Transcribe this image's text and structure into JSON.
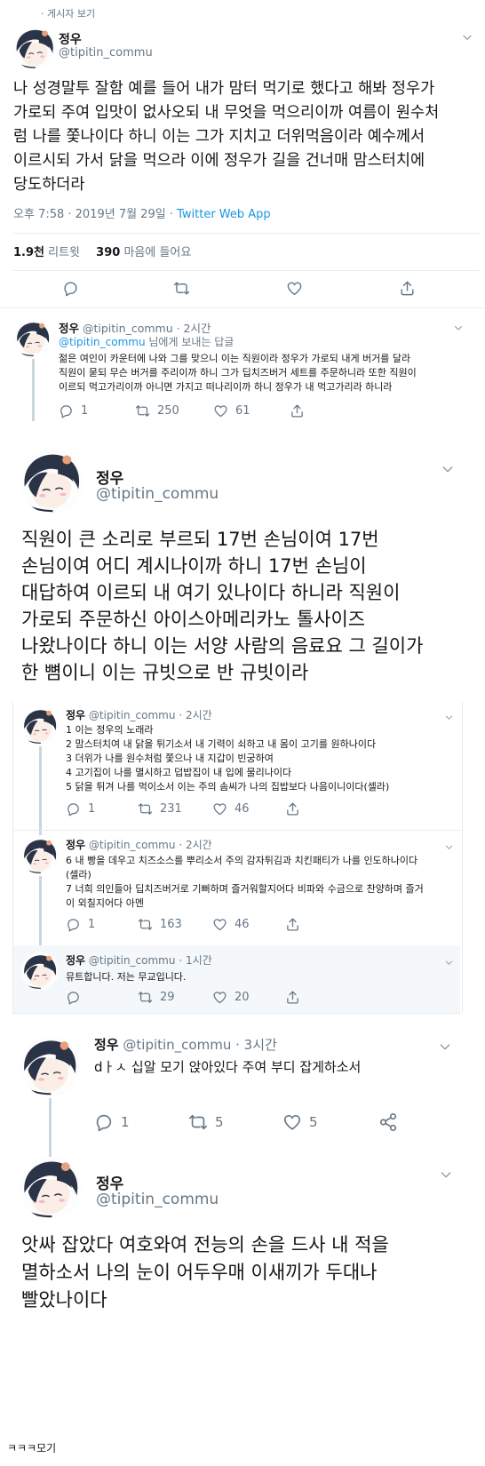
{
  "top_fragment": "· 게시자 보기",
  "main": {
    "name": "정우",
    "handle": "@tipitin_commu",
    "lines": [
      "나 성경말투 잘함 예를 들어 내가 맘터 먹기로 했다고 해봐 정우가",
      "가로되 주여 입맛이 없사오되 내 무엇을 먹으리이까 여름이 원수처",
      "럼 나를 쫓나이다 하니 이는 그가 지치고 더위먹음이라 예수께서",
      "이르시되 가서 닭을 먹으라 이에 정우가 길을 건너매 맘스터치에",
      "당도하더라"
    ],
    "timestamp": "오후 7:58 · 2019년 7월 29일 · ",
    "source": "Twitter Web App",
    "retweets_count": "1.9천",
    "retweets_label": "리트윗",
    "likes_count": "390",
    "likes_label": "마음에 들어요"
  },
  "reply1": {
    "name": "정우",
    "handle": "@tipitin_commu",
    "time": "· 2시간",
    "replying_handle": "@tipitin_commu",
    "replying_suffix": "님에게 보내는 답글",
    "lines": [
      "젊은 여인이 카운터에 나와 그를 맞으니 이는 직원이라 정우가 가로되 내게 버거를 달라",
      "직원이 묻되 무슨 버거를 주리이까 하니 그가 딥치즈버거 세트를 주문하니라 또한 직원이",
      "이르되 먹고가리이까 아니면 가지고 떠나리이까 하니 정우가 내 먹고가리라 하니라"
    ],
    "replies": "1",
    "retweets": "250",
    "likes": "61"
  },
  "big1": {
    "name": "정우",
    "handle": "@tipitin_commu",
    "lines": [
      "직원이 큰 소리로 부르되 17번 손님이여 17번",
      "손님이여 어디 계시나이까 하니 17번 손님이",
      "대답하여 이르되 내 여기 있나이다 하니라 직원이",
      "가로되 주문하신 아이스아메리카노 톨사이즈",
      "나왔나이다 하니 이는 서양 사람의 음료요 그 길이가",
      "한 뼘이니 이는 규빗으로 반 규빗이라"
    ]
  },
  "inner1": {
    "name": "정우",
    "handle": "@tipitin_commu",
    "time": "· 2시간",
    "lines": [
      "1 이는 정우의 노래라",
      "2 맘스터치여 내 닭을 튀기소서 내 기력이 쇠하고 내 몸이 고기를 원하나이다",
      "3 더위가 나를 원수처럼 쫓으나 내 지갑이 빈궁하여",
      "4 고기집이 나를 멸시하고 덥밥집이 내 입에 물리나이다",
      "5 닭을 튀겨 나를 먹이소서 이는 주의 솜씨가 나의 집밥보다 나음이니이다(셀라)"
    ],
    "replies": "1",
    "retweets": "231",
    "likes": "46"
  },
  "inner2": {
    "name": "정우",
    "handle": "@tipitin_commu",
    "time": "· 2시간",
    "lines": [
      "6 내 빵을 데우고 치즈소스를 뿌리소서 주의 감자튀김과 치킨패티가 나를 인도하나이다",
      "(셀라)",
      "7 너희 의인들아 딥치즈버거로 기뻐하며 즐거워할지어다 비파와 수금으로 찬양하며 즐거",
      "이 외칠지어다 아멘"
    ],
    "replies": "1",
    "retweets": "163",
    "likes": "46"
  },
  "inner3": {
    "name": "정우",
    "handle": "@tipitin_commu",
    "time": "· 1시간",
    "text": "뮤트합니다. 저는 무교입니다.",
    "retweets": "29",
    "likes": "20"
  },
  "reply2": {
    "name": "정우",
    "handle": "@tipitin_commu",
    "time": "· 3시간",
    "text": "dㅏㅅ 십알 모기 앉아있다 주여 부디 잡게하소서",
    "replies": "1",
    "retweets": "5",
    "likes": "5"
  },
  "big2": {
    "name": "정우",
    "handle": "@tipitin_commu",
    "lines": [
      "앗싸 잡았다 여호와여 전능의 손을 드사 내 적을",
      "멸하소서 나의 눈이 어두우매 이새끼가 두대나",
      "빨았나이다"
    ]
  },
  "footer_caption": "ㅋㅋㅋ모기",
  "icons": {
    "reply": "reply-icon",
    "retweet": "retweet-icon",
    "like": "heart-icon",
    "share": "share-icon",
    "more": "chevron-down-icon"
  },
  "colors": {
    "link": "#1b95e0",
    "text": "#14171a",
    "muted": "#657786",
    "divider": "#e6ecf0",
    "highlight": "#f5f8fa"
  }
}
